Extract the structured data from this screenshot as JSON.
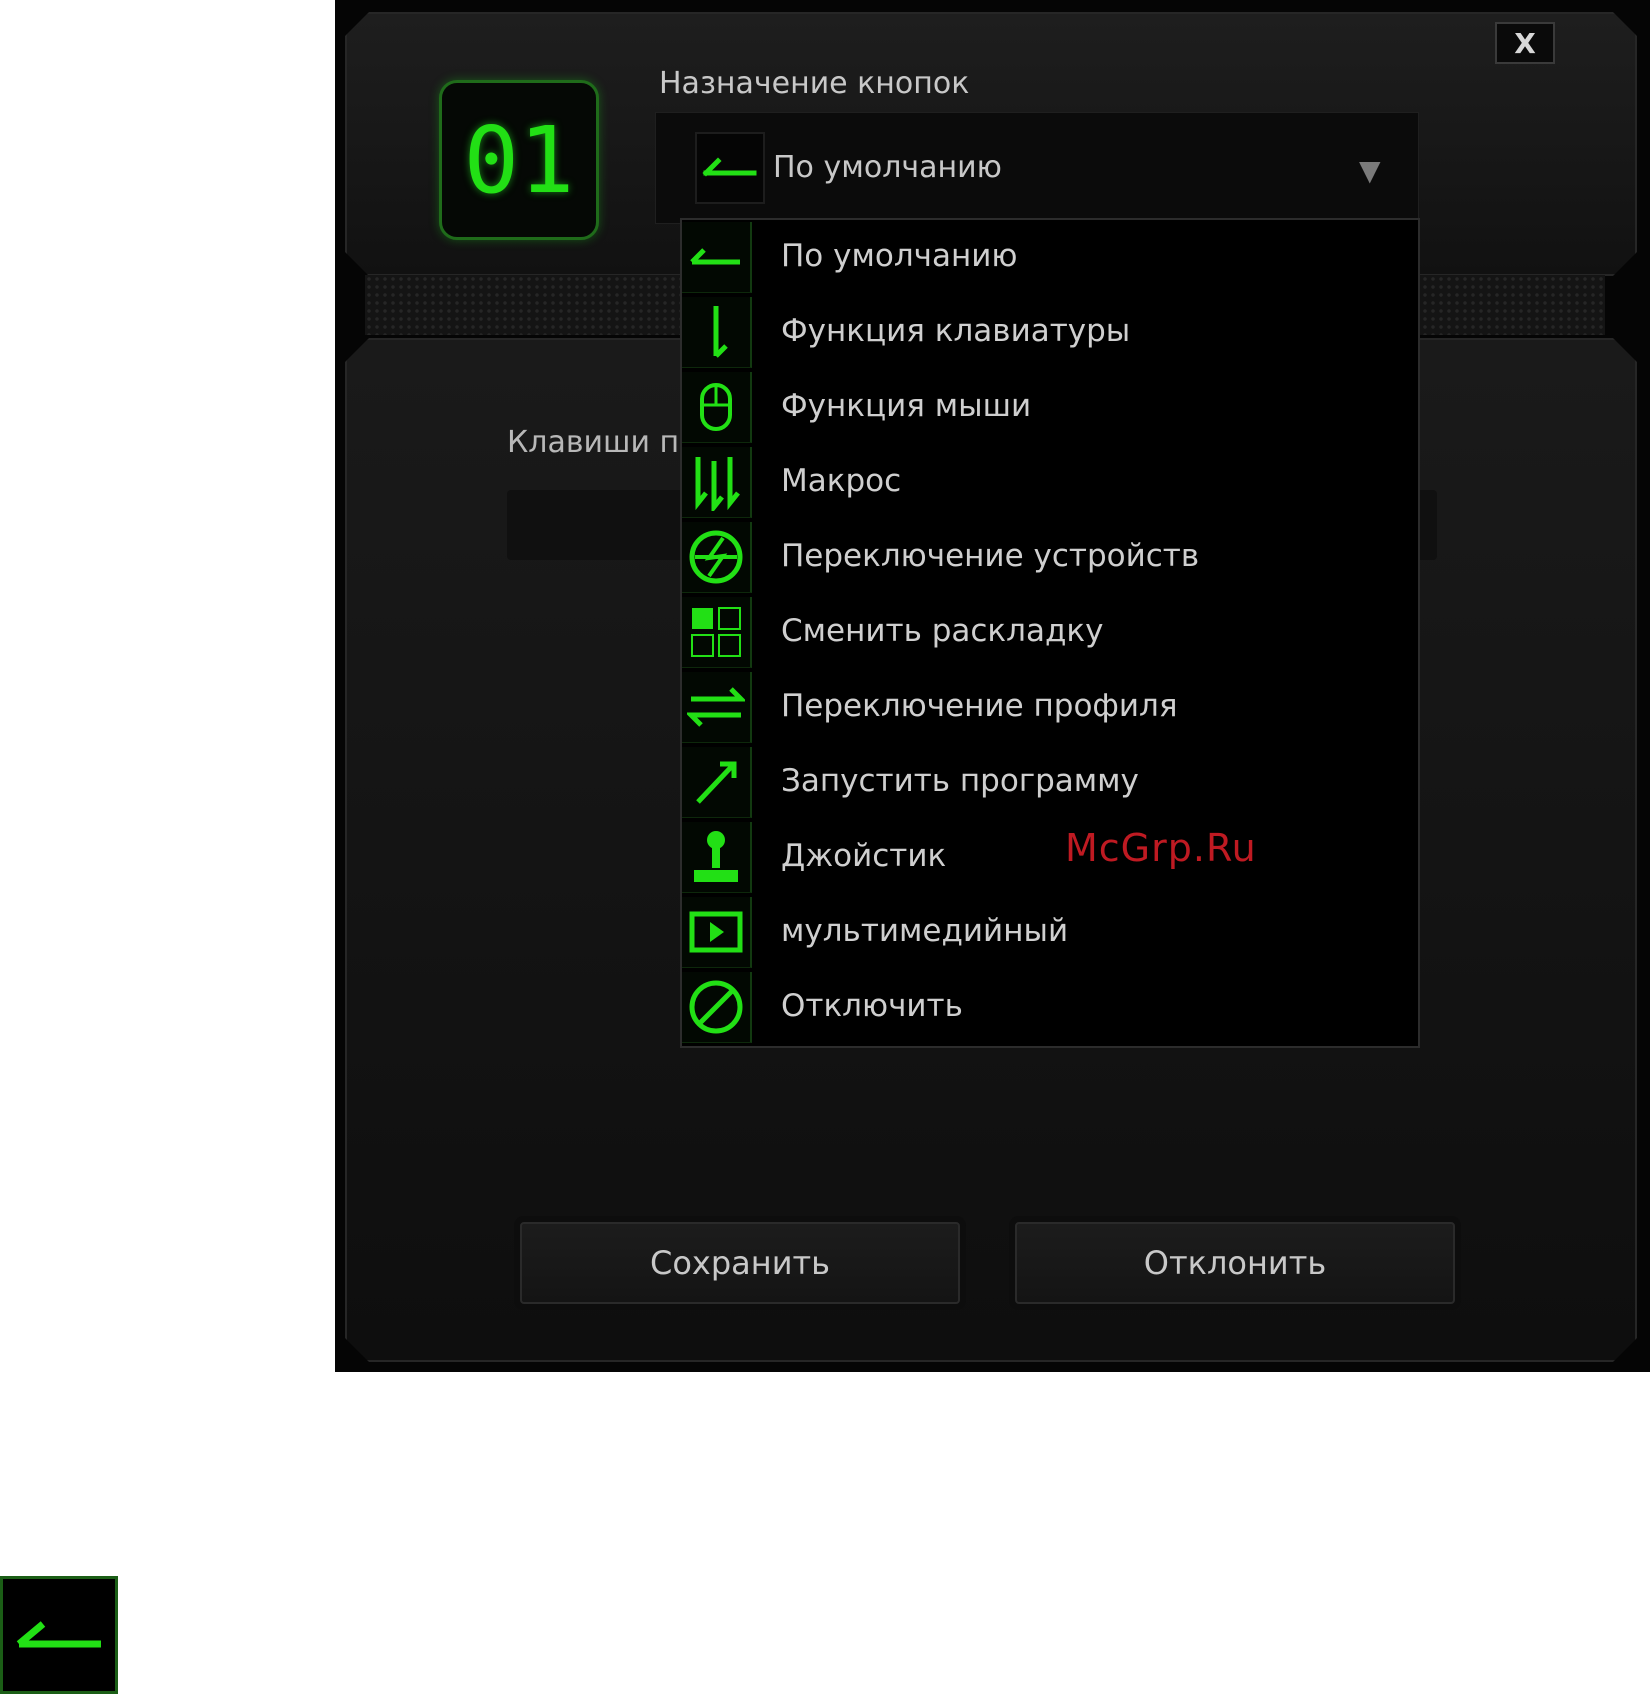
{
  "dialog": {
    "button_number": "01",
    "section_label": "Назначение кнопок",
    "close_label": "X",
    "selected_value": "По умолчанию",
    "keys_label": "Клавиши п",
    "save_label": "Сохранить",
    "cancel_label": "Отклонить"
  },
  "dropdown": {
    "items": [
      {
        "label": "По умолчанию",
        "icon": "default-arrow-icon"
      },
      {
        "label": "Функция клавиатуры",
        "icon": "keyboard-function-icon"
      },
      {
        "label": "Функция мыши",
        "icon": "mouse-icon"
      },
      {
        "label": "Макрос",
        "icon": "macro-icon"
      },
      {
        "label": "Переключение устройств",
        "icon": "device-switch-icon"
      },
      {
        "label": "Сменить раскладку",
        "icon": "layout-grid-icon"
      },
      {
        "label": "Переключение профиля",
        "icon": "profile-switch-icon"
      },
      {
        "label": "Запустить программу",
        "icon": "launch-program-icon"
      },
      {
        "label": "Джойстик",
        "icon": "joystick-icon"
      },
      {
        "label": "мультимедийный",
        "icon": "multimedia-icon"
      },
      {
        "label": "Отключить",
        "icon": "disable-icon"
      }
    ]
  },
  "watermark": "McGrp.Ru",
  "colors": {
    "accent_green": "#22e015",
    "background": "#050505",
    "text": "#c8c8c8"
  }
}
